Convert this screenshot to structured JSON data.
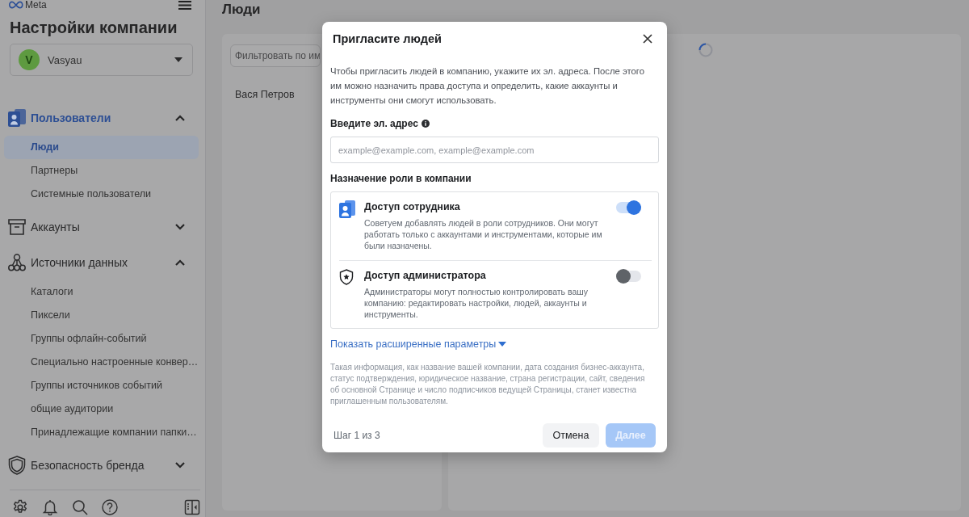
{
  "sidebar": {
    "logo": "Meta",
    "title": "Настройки компании",
    "account": {
      "initial": "V",
      "name": "Vasyau"
    },
    "sections": [
      {
        "kind": "users",
        "label": "Пользователи",
        "selected": true,
        "expanded": true,
        "items": [
          {
            "label": "Люди",
            "selected": true
          },
          {
            "label": "Партнеры",
            "selected": false
          },
          {
            "label": "Системные пользователи",
            "selected": false
          }
        ]
      },
      {
        "kind": "accounts",
        "label": "Аккаунты",
        "selected": false,
        "expanded": false
      },
      {
        "kind": "data_sources",
        "label": "Источники данных",
        "selected": false,
        "expanded": true,
        "items": [
          {
            "label": "Каталоги",
            "selected": false
          },
          {
            "label": "Пиксели",
            "selected": false
          },
          {
            "label": "Группы офлайн-событий",
            "selected": false
          },
          {
            "label": "Специально настроенные конвер…",
            "selected": false
          },
          {
            "label": "Группы источников событий",
            "selected": false
          },
          {
            "label": "общие аудитории",
            "selected": false
          },
          {
            "label": "Принадлежащие компании папки…",
            "selected": false
          }
        ]
      },
      {
        "kind": "brand_safety",
        "label": "Безопасность бренда",
        "selected": false,
        "expanded": false
      }
    ]
  },
  "main": {
    "title": "Люди",
    "filter": {
      "placeholder": "Фильтровать по им"
    },
    "people": [
      {
        "name": "Вася Петров"
      }
    ],
    "details": {
      "loading": true
    }
  },
  "dialog": {
    "title": "Пригласите людей",
    "intro": "Чтобы пригласить людей в компанию, укажите их эл. адреса. После этого им можно назначить права доступа и определить, какие аккаунты и инструменты они смогут использовать.",
    "email_label": "Введите эл. адрес",
    "email": {
      "placeholder": "example@example.com, example@example.com"
    },
    "roles_label": "Назначение роли в компании",
    "roles": [
      {
        "kind": "employee",
        "title": "Доступ сотрудника",
        "description": "Советуем добавлять людей в роли сотрудников. Они могут работать только с аккаунтами и инструментами, которые им были назначены.",
        "on": true
      },
      {
        "kind": "admin",
        "title": "Доступ администратора",
        "description": "Администраторы могут полностью контролировать вашу компанию: редактировать настройки, людей, аккаунты и инструменты.",
        "on": false
      }
    ],
    "advanced_link": "Показать расширенные параметры",
    "notice": "Такая информация, как название вашей компании, дата создания бизнес-аккаунта, статус подтверждения, юридическое название, страна регистрации, сайт, сведения об основной Странице и число подписчиков ведущей Страницы, станет известна приглашенным пользователям.",
    "step": "Шаг 1 из 3",
    "buttons": [
      {
        "kind": "cancel",
        "label": "Отмена",
        "disabled": false
      },
      {
        "kind": "next",
        "label": "Далее",
        "disabled": true
      }
    ]
  }
}
